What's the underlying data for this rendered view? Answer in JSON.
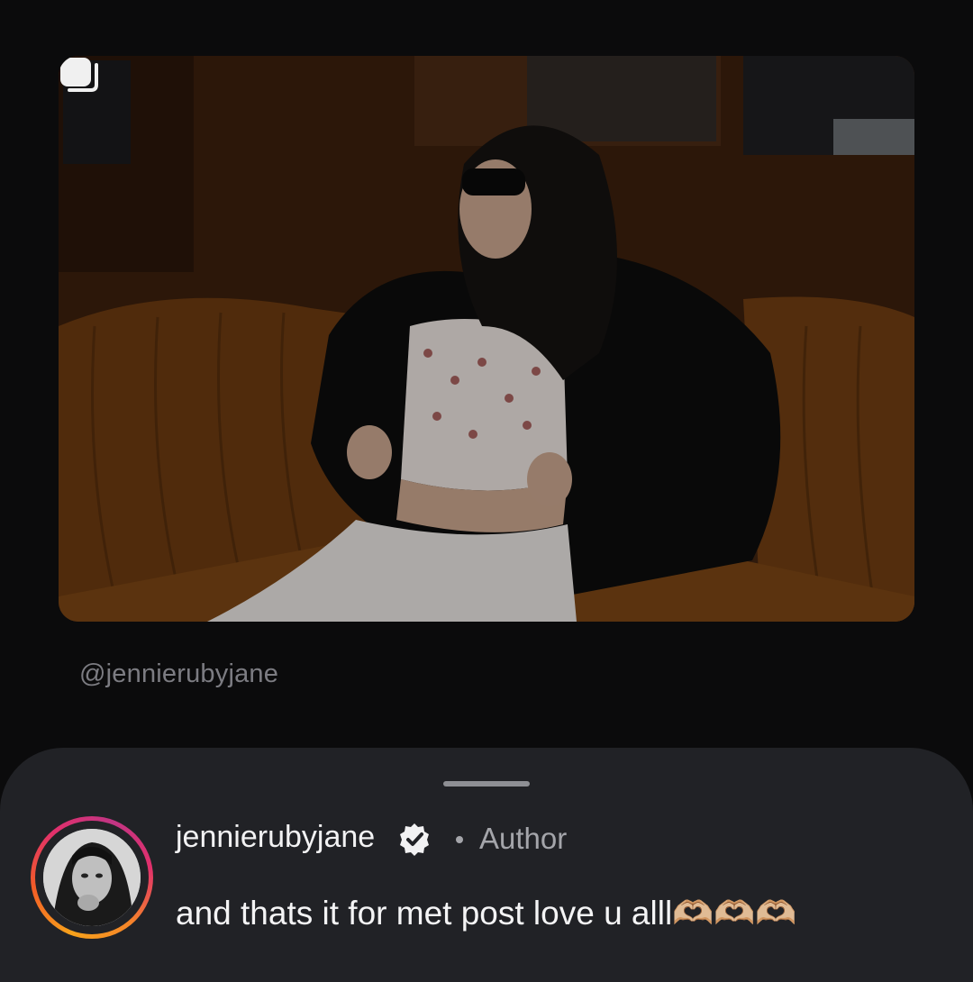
{
  "post": {
    "image_description_icon": "multiple-posts-icon",
    "handle": "@jennierubyjane"
  },
  "comment": {
    "username": "jennierubyjane",
    "verified": true,
    "separator": "•",
    "author_label": "Author",
    "text": "and thats it for met post love u alll🫶🏼🫶🏼🫶🏼"
  },
  "colors": {
    "background": "#0b0b0c",
    "sheet": "#212226",
    "muted_text": "#7c7c82"
  }
}
